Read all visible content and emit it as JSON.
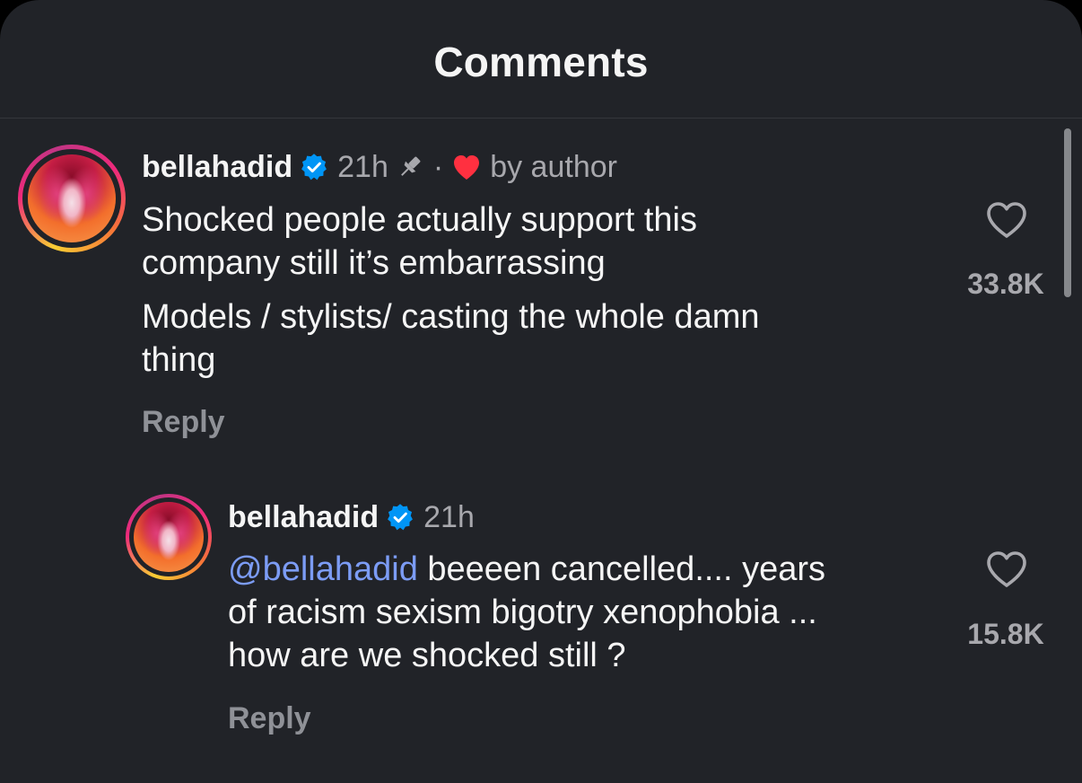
{
  "header": {
    "title": "Comments"
  },
  "colors": {
    "background": "#212328",
    "text": "#f5f5f5",
    "secondary_text": "#a8a8ad",
    "mention": "#7c9cf5",
    "verified_badge": "#0095f6",
    "author_heart": "#ff3040"
  },
  "icons": {
    "verified": "verified-badge-icon",
    "pin": "pin-icon",
    "author_heart": "heart-filled-icon",
    "like": "heart-outline-icon"
  },
  "comments": [
    {
      "username": "bellahadid",
      "verified": true,
      "time": "21h",
      "pinned": true,
      "separator": "·",
      "liked_by_author_label": "by author",
      "lines": [
        "Shocked people actually support this",
        "company still it’s embarrassing",
        "Models / stylists/ casting the whole damn",
        "thing"
      ],
      "reply_label": "Reply",
      "likes": "33.8K"
    },
    {
      "username": "bellahadid",
      "verified": true,
      "time": "21h",
      "mention": "@bellahadid",
      "lines": [
        " beeeen cancelled.... years",
        "of racism sexism bigotry xenophobia ...",
        "how are we shocked still ?"
      ],
      "reply_label": "Reply",
      "likes": "15.8K"
    }
  ]
}
